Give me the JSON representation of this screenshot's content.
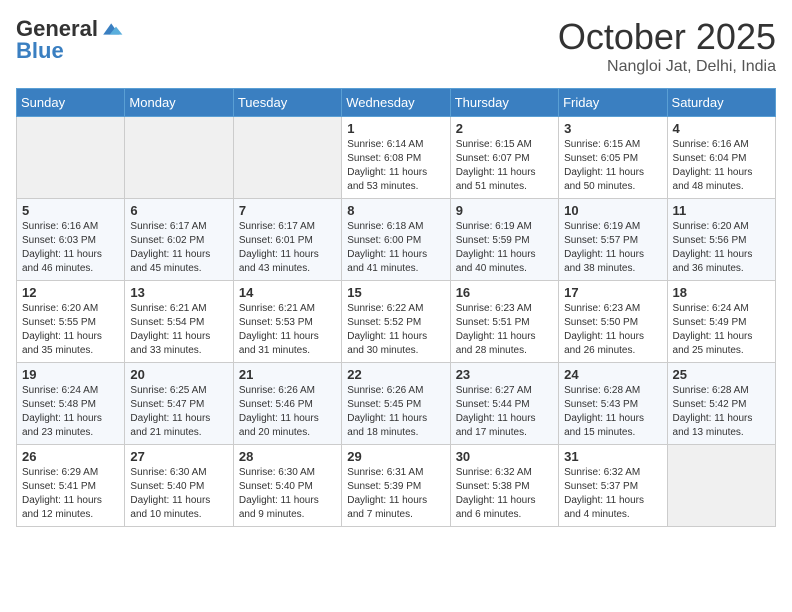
{
  "logo": {
    "general": "General",
    "blue": "Blue"
  },
  "header": {
    "month": "October 2025",
    "location": "Nangloi Jat, Delhi, India"
  },
  "weekdays": [
    "Sunday",
    "Monday",
    "Tuesday",
    "Wednesday",
    "Thursday",
    "Friday",
    "Saturday"
  ],
  "weeks": [
    [
      {
        "day": "",
        "sunrise": "",
        "sunset": "",
        "daylight": ""
      },
      {
        "day": "",
        "sunrise": "",
        "sunset": "",
        "daylight": ""
      },
      {
        "day": "",
        "sunrise": "",
        "sunset": "",
        "daylight": ""
      },
      {
        "day": "1",
        "sunrise": "Sunrise: 6:14 AM",
        "sunset": "Sunset: 6:08 PM",
        "daylight": "Daylight: 11 hours and 53 minutes."
      },
      {
        "day": "2",
        "sunrise": "Sunrise: 6:15 AM",
        "sunset": "Sunset: 6:07 PM",
        "daylight": "Daylight: 11 hours and 51 minutes."
      },
      {
        "day": "3",
        "sunrise": "Sunrise: 6:15 AM",
        "sunset": "Sunset: 6:05 PM",
        "daylight": "Daylight: 11 hours and 50 minutes."
      },
      {
        "day": "4",
        "sunrise": "Sunrise: 6:16 AM",
        "sunset": "Sunset: 6:04 PM",
        "daylight": "Daylight: 11 hours and 48 minutes."
      }
    ],
    [
      {
        "day": "5",
        "sunrise": "Sunrise: 6:16 AM",
        "sunset": "Sunset: 6:03 PM",
        "daylight": "Daylight: 11 hours and 46 minutes."
      },
      {
        "day": "6",
        "sunrise": "Sunrise: 6:17 AM",
        "sunset": "Sunset: 6:02 PM",
        "daylight": "Daylight: 11 hours and 45 minutes."
      },
      {
        "day": "7",
        "sunrise": "Sunrise: 6:17 AM",
        "sunset": "Sunset: 6:01 PM",
        "daylight": "Daylight: 11 hours and 43 minutes."
      },
      {
        "day": "8",
        "sunrise": "Sunrise: 6:18 AM",
        "sunset": "Sunset: 6:00 PM",
        "daylight": "Daylight: 11 hours and 41 minutes."
      },
      {
        "day": "9",
        "sunrise": "Sunrise: 6:19 AM",
        "sunset": "Sunset: 5:59 PM",
        "daylight": "Daylight: 11 hours and 40 minutes."
      },
      {
        "day": "10",
        "sunrise": "Sunrise: 6:19 AM",
        "sunset": "Sunset: 5:57 PM",
        "daylight": "Daylight: 11 hours and 38 minutes."
      },
      {
        "day": "11",
        "sunrise": "Sunrise: 6:20 AM",
        "sunset": "Sunset: 5:56 PM",
        "daylight": "Daylight: 11 hours and 36 minutes."
      }
    ],
    [
      {
        "day": "12",
        "sunrise": "Sunrise: 6:20 AM",
        "sunset": "Sunset: 5:55 PM",
        "daylight": "Daylight: 11 hours and 35 minutes."
      },
      {
        "day": "13",
        "sunrise": "Sunrise: 6:21 AM",
        "sunset": "Sunset: 5:54 PM",
        "daylight": "Daylight: 11 hours and 33 minutes."
      },
      {
        "day": "14",
        "sunrise": "Sunrise: 6:21 AM",
        "sunset": "Sunset: 5:53 PM",
        "daylight": "Daylight: 11 hours and 31 minutes."
      },
      {
        "day": "15",
        "sunrise": "Sunrise: 6:22 AM",
        "sunset": "Sunset: 5:52 PM",
        "daylight": "Daylight: 11 hours and 30 minutes."
      },
      {
        "day": "16",
        "sunrise": "Sunrise: 6:23 AM",
        "sunset": "Sunset: 5:51 PM",
        "daylight": "Daylight: 11 hours and 28 minutes."
      },
      {
        "day": "17",
        "sunrise": "Sunrise: 6:23 AM",
        "sunset": "Sunset: 5:50 PM",
        "daylight": "Daylight: 11 hours and 26 minutes."
      },
      {
        "day": "18",
        "sunrise": "Sunrise: 6:24 AM",
        "sunset": "Sunset: 5:49 PM",
        "daylight": "Daylight: 11 hours and 25 minutes."
      }
    ],
    [
      {
        "day": "19",
        "sunrise": "Sunrise: 6:24 AM",
        "sunset": "Sunset: 5:48 PM",
        "daylight": "Daylight: 11 hours and 23 minutes."
      },
      {
        "day": "20",
        "sunrise": "Sunrise: 6:25 AM",
        "sunset": "Sunset: 5:47 PM",
        "daylight": "Daylight: 11 hours and 21 minutes."
      },
      {
        "day": "21",
        "sunrise": "Sunrise: 6:26 AM",
        "sunset": "Sunset: 5:46 PM",
        "daylight": "Daylight: 11 hours and 20 minutes."
      },
      {
        "day": "22",
        "sunrise": "Sunrise: 6:26 AM",
        "sunset": "Sunset: 5:45 PM",
        "daylight": "Daylight: 11 hours and 18 minutes."
      },
      {
        "day": "23",
        "sunrise": "Sunrise: 6:27 AM",
        "sunset": "Sunset: 5:44 PM",
        "daylight": "Daylight: 11 hours and 17 minutes."
      },
      {
        "day": "24",
        "sunrise": "Sunrise: 6:28 AM",
        "sunset": "Sunset: 5:43 PM",
        "daylight": "Daylight: 11 hours and 15 minutes."
      },
      {
        "day": "25",
        "sunrise": "Sunrise: 6:28 AM",
        "sunset": "Sunset: 5:42 PM",
        "daylight": "Daylight: 11 hours and 13 minutes."
      }
    ],
    [
      {
        "day": "26",
        "sunrise": "Sunrise: 6:29 AM",
        "sunset": "Sunset: 5:41 PM",
        "daylight": "Daylight: 11 hours and 12 minutes."
      },
      {
        "day": "27",
        "sunrise": "Sunrise: 6:30 AM",
        "sunset": "Sunset: 5:40 PM",
        "daylight": "Daylight: 11 hours and 10 minutes."
      },
      {
        "day": "28",
        "sunrise": "Sunrise: 6:30 AM",
        "sunset": "Sunset: 5:40 PM",
        "daylight": "Daylight: 11 hours and 9 minutes."
      },
      {
        "day": "29",
        "sunrise": "Sunrise: 6:31 AM",
        "sunset": "Sunset: 5:39 PM",
        "daylight": "Daylight: 11 hours and 7 minutes."
      },
      {
        "day": "30",
        "sunrise": "Sunrise: 6:32 AM",
        "sunset": "Sunset: 5:38 PM",
        "daylight": "Daylight: 11 hours and 6 minutes."
      },
      {
        "day": "31",
        "sunrise": "Sunrise: 6:32 AM",
        "sunset": "Sunset: 5:37 PM",
        "daylight": "Daylight: 11 hours and 4 minutes."
      },
      {
        "day": "",
        "sunrise": "",
        "sunset": "",
        "daylight": ""
      }
    ]
  ]
}
